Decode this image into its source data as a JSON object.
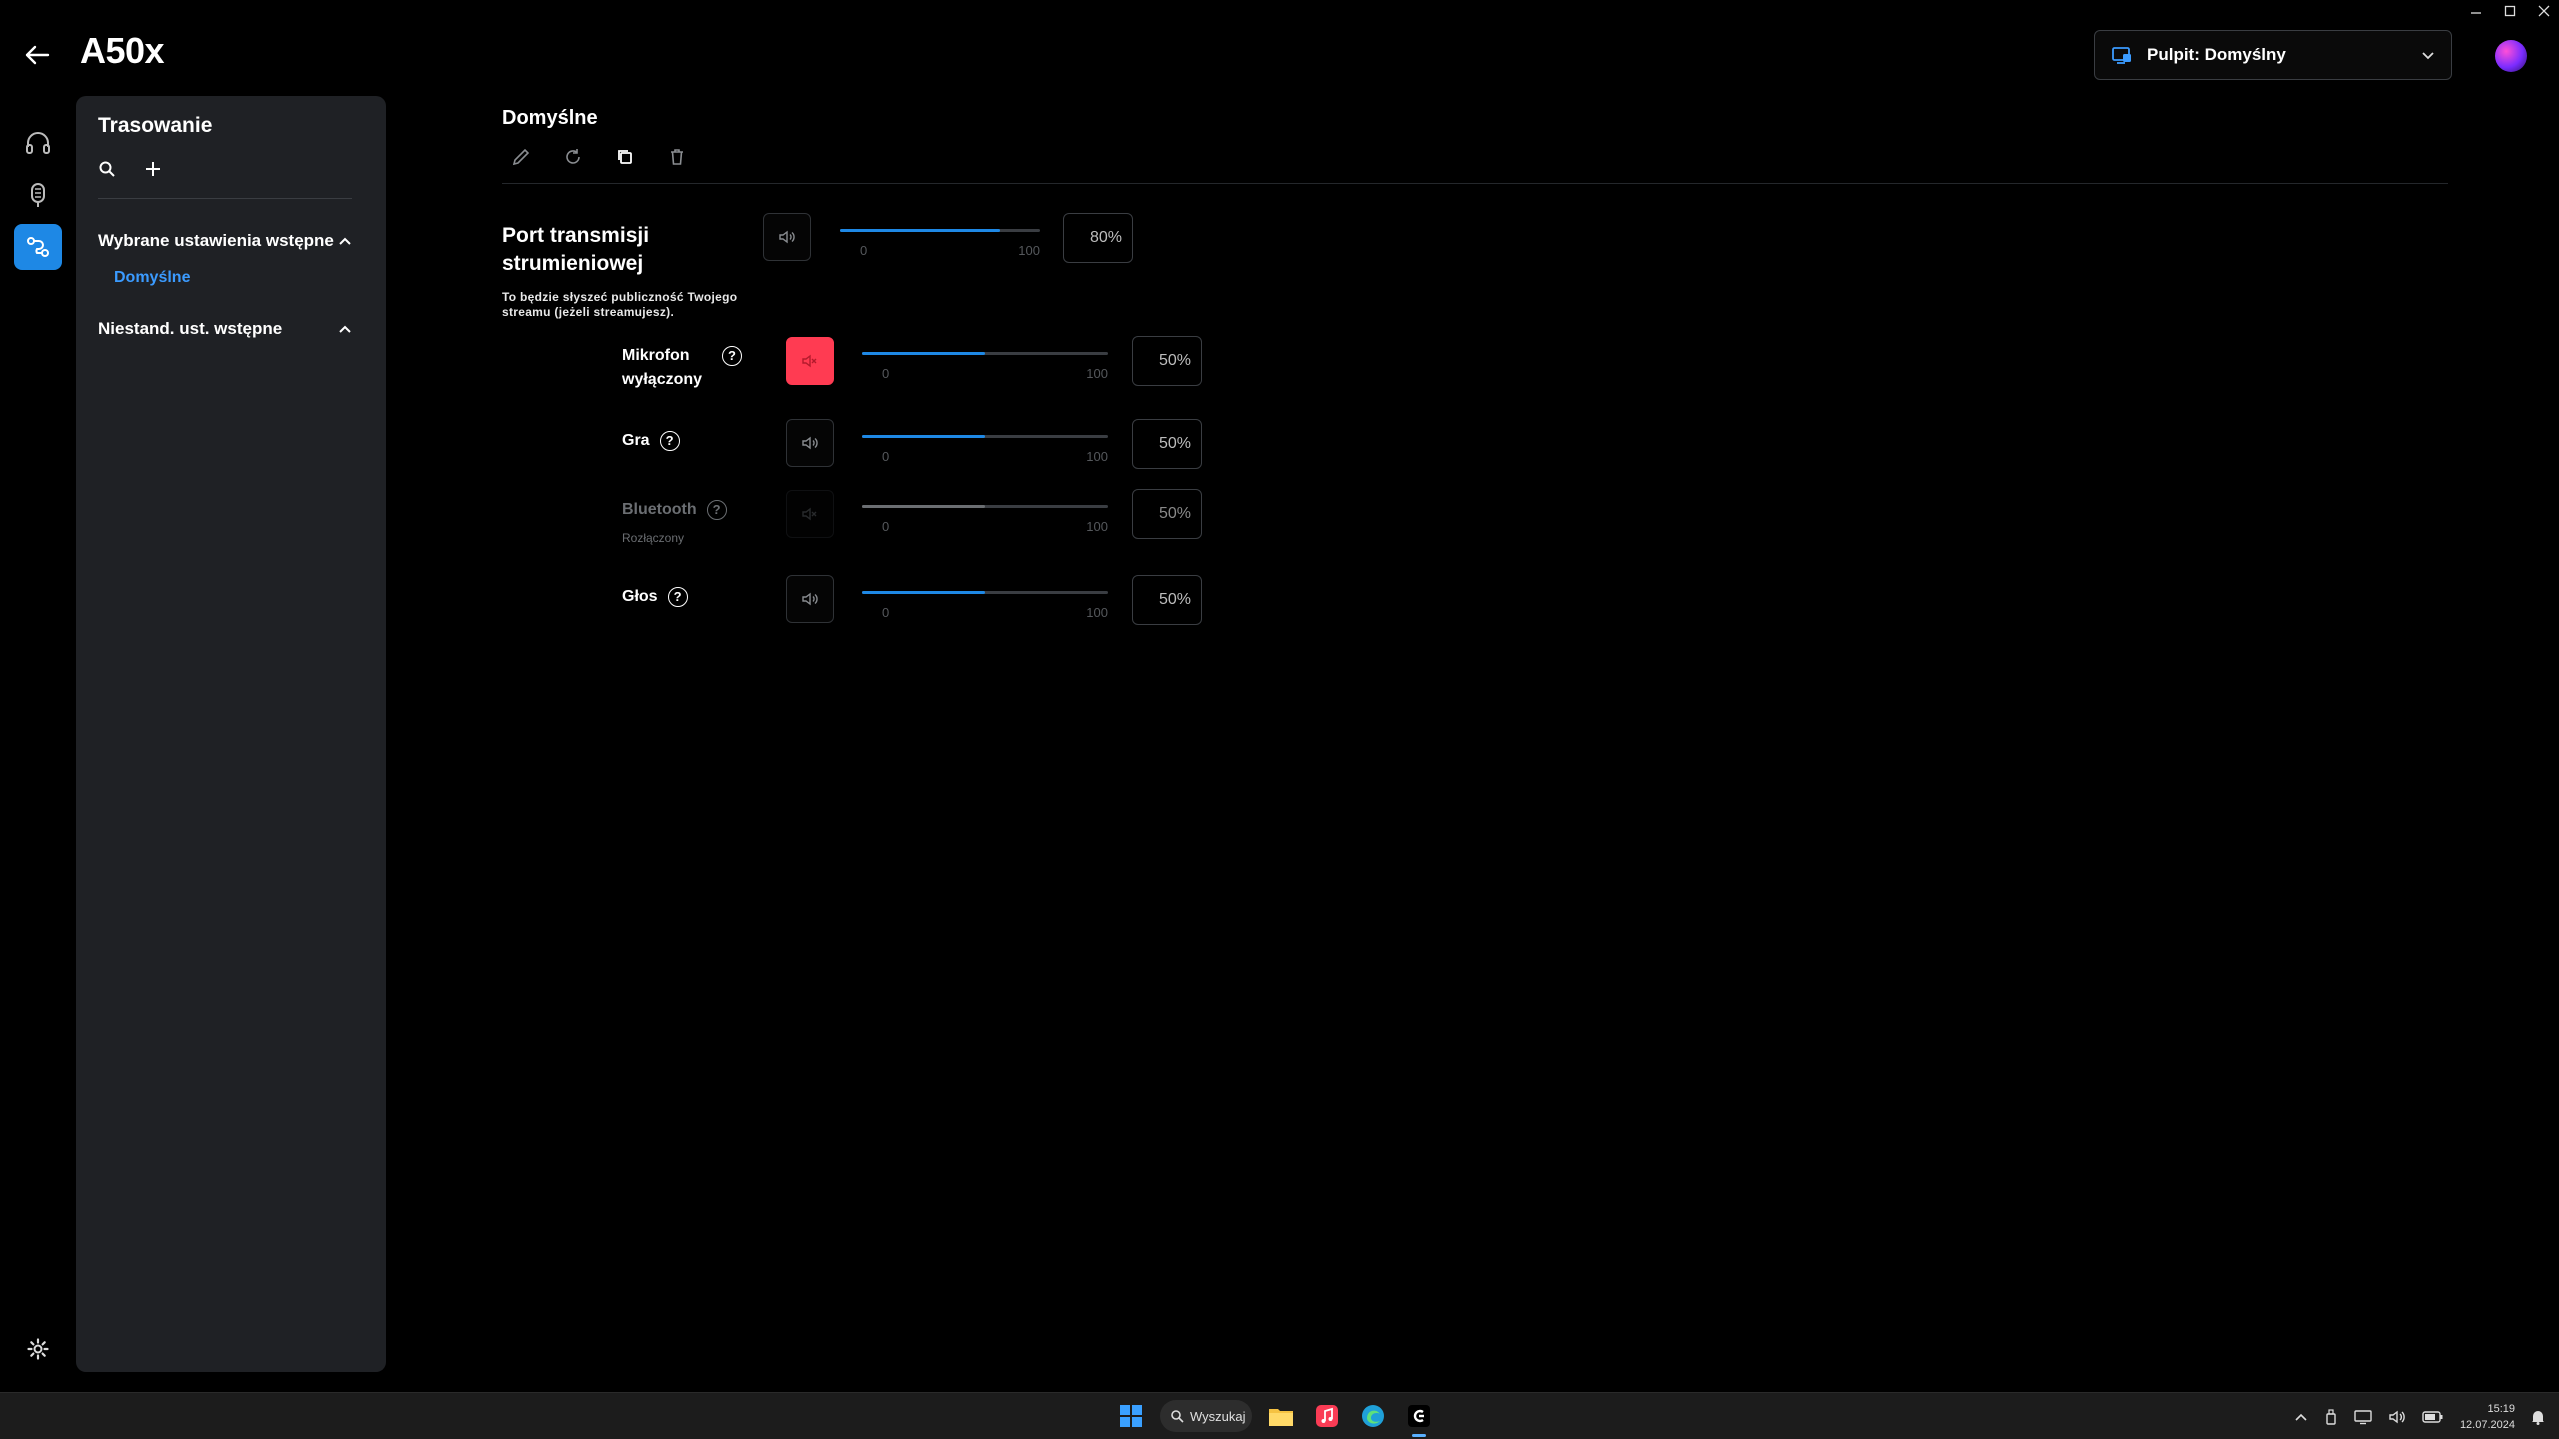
{
  "app": {
    "title": "A50x",
    "profile_label": "Pulpit: Domyślny"
  },
  "sidebar": {
    "title": "Trasowanie",
    "section_selected": "Wybrane ustawienia wstępne",
    "preset_active": "Domyślne",
    "section_custom": "Niestand. ust. wstępne"
  },
  "preset": {
    "title": "Domyślne"
  },
  "stream": {
    "title": "Port transmisji strumieniowej",
    "description": "To będzie słyszeć publiczność Twojego streamu (jeżeli streamujesz).",
    "value": 80,
    "value_text": "80%",
    "min": "0",
    "max": "100"
  },
  "channels": [
    {
      "label": "Mikrofon wyłączony",
      "sub": "",
      "value": 50,
      "value_text": "50%",
      "min": "0",
      "max": "100",
      "muted": true,
      "disabled": false
    },
    {
      "label": "Gra",
      "sub": "",
      "value": 50,
      "value_text": "50%",
      "min": "0",
      "max": "100",
      "muted": false,
      "disabled": false
    },
    {
      "label": "Bluetooth",
      "sub": "Rozłączony",
      "value": 50,
      "value_text": "50%",
      "min": "0",
      "max": "100",
      "muted": false,
      "disabled": true
    },
    {
      "label": "Głos",
      "sub": "",
      "value": 50,
      "value_text": "50%",
      "min": "0",
      "max": "100",
      "muted": false,
      "disabled": false
    }
  ],
  "taskbar": {
    "search_label": "Wyszukaj",
    "time": "15:19",
    "date": "12.07.2024"
  },
  "colors": {
    "accent": "#1e88e5",
    "link": "#3b9bff",
    "muted": "#ff3b52",
    "panel": "#1f2125"
  },
  "icons": [
    "back-arrow-icon",
    "headphones-icon",
    "microphone-icon",
    "routing-icon",
    "settings-gear-icon",
    "search-icon",
    "plus-icon",
    "chevron-up-icon",
    "edit-pencil-icon",
    "reset-icon",
    "duplicate-icon",
    "trash-icon",
    "speaker-icon",
    "speaker-muted-icon",
    "help-icon",
    "desktop-profile-icon",
    "chevron-down-icon"
  ]
}
